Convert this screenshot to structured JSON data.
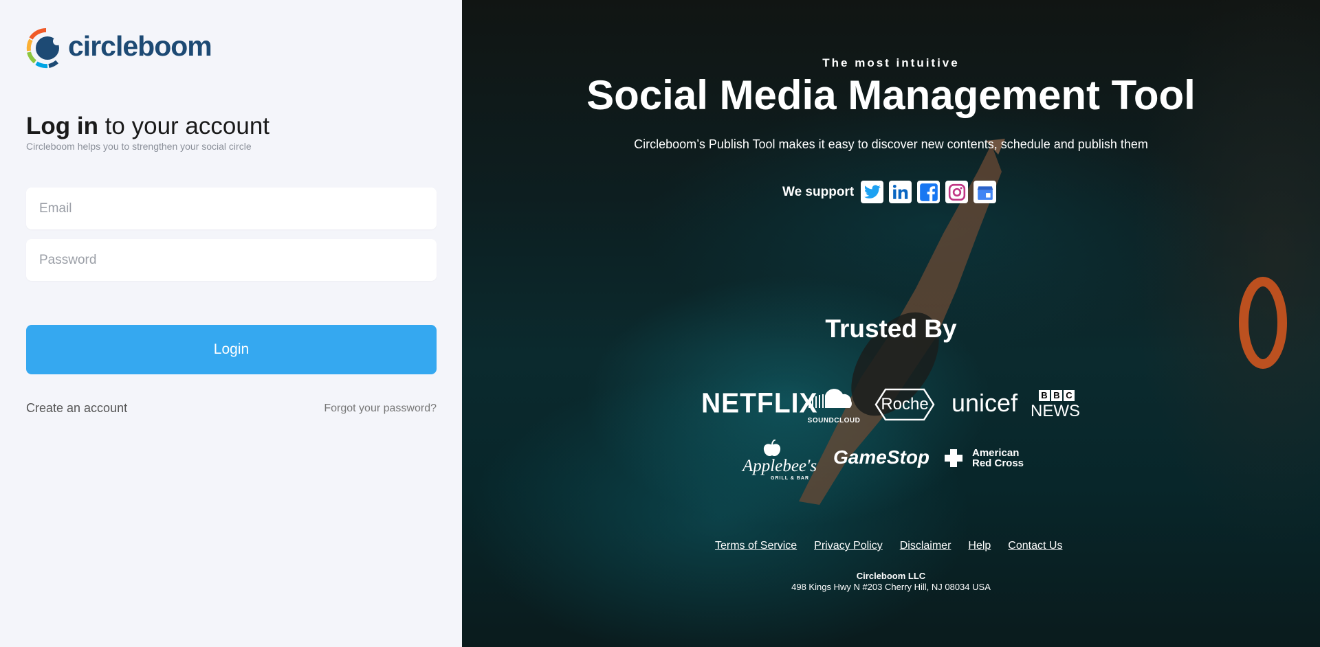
{
  "brand": {
    "name": "circleboom"
  },
  "login": {
    "heading_bold": "Log in",
    "heading_rest": " to your account",
    "subheading": "Circleboom helps you to strengthen your social circle",
    "email_placeholder": "Email",
    "password_placeholder": "Password",
    "login_button": "Login",
    "create_account": "Create an account",
    "forgot_password": "Forgot your password?"
  },
  "hero": {
    "tagline": "The most intuitive",
    "title": "Social Media Management Tool",
    "description": "Circleboom’s Publish Tool makes it easy to discover new contents, schedule and publish them",
    "support_label": "We support",
    "networks": [
      {
        "icon": "twitter-icon",
        "color": "#1da1f2"
      },
      {
        "icon": "linkedin-icon",
        "color": "#0a66c2"
      },
      {
        "icon": "facebook-icon",
        "color": "#1877f2"
      },
      {
        "icon": "instagram-icon",
        "color": "#c13584"
      },
      {
        "icon": "google-business-icon",
        "color": "#4285f4"
      }
    ],
    "trusted_label": "Trusted By",
    "brands": {
      "netflix": "NETFLIX",
      "soundcloud": "SOUNDCLOUD",
      "roche": "Roche",
      "unicef": "unicef",
      "bbc_top": [
        "B",
        "B",
        "C"
      ],
      "bbc_bottom": "NEWS",
      "applebees": "Applebee's",
      "applebees_sub": "GRILL & BAR",
      "gamestop": "GameStop",
      "redcross_line1": "American",
      "redcross_line2": "Red Cross"
    }
  },
  "footer": {
    "links": [
      "Terms of Service",
      "Privacy Policy",
      "Disclaimer",
      "Help",
      "Contact Us"
    ],
    "company": "Circleboom LLC",
    "address": "498 Kings Hwy N #203 Cherry Hill, NJ 08034 USA"
  }
}
